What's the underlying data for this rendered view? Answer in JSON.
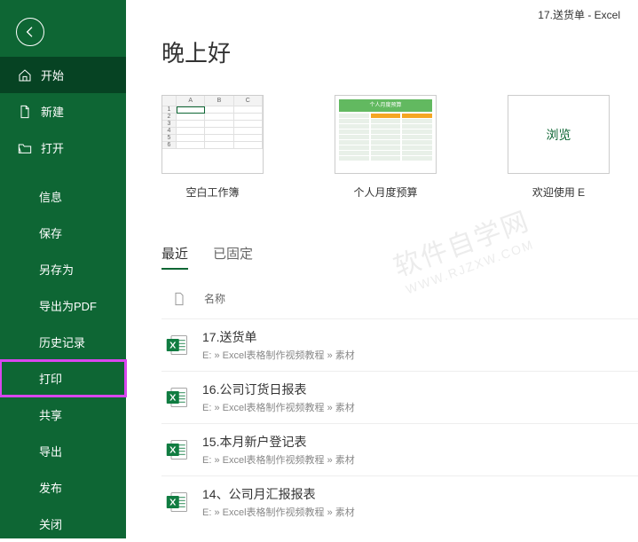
{
  "titlebar": "17.送货单  -  Excel",
  "sidebar": {
    "primary": [
      {
        "label": "开始",
        "icon": "home",
        "active": true
      },
      {
        "label": "新建",
        "icon": "file"
      },
      {
        "label": "打开",
        "icon": "folder-open"
      }
    ],
    "secondary": [
      {
        "label": "信息"
      },
      {
        "label": "保存"
      },
      {
        "label": "另存为"
      },
      {
        "label": "导出为PDF"
      },
      {
        "label": "历史记录"
      },
      {
        "label": "打印",
        "highlighted": true
      },
      {
        "label": "共享"
      },
      {
        "label": "导出"
      },
      {
        "label": "发布"
      },
      {
        "label": "关闭"
      }
    ]
  },
  "page_title": "晚上好",
  "templates": [
    {
      "label": "空白工作簿",
      "type": "blank"
    },
    {
      "label": "个人月度预算",
      "type": "budget",
      "preview_title": "个人月度预算"
    },
    {
      "label": "欢迎使用 E",
      "type": "browse",
      "browse_text": "浏览"
    }
  ],
  "tabs": [
    {
      "label": "最近",
      "active": true
    },
    {
      "label": "已固定"
    }
  ],
  "list_header": {
    "name_col": "名称"
  },
  "recent_files": [
    {
      "name": "17.送货单",
      "path": "E: » Excel表格制作视频教程 » 素材"
    },
    {
      "name": "16.公司订货日报表",
      "path": "E: » Excel表格制作视频教程 » 素材"
    },
    {
      "name": "15.本月新户登记表",
      "path": "E: » Excel表格制作视频教程 » 素材"
    },
    {
      "name": "14、公司月汇报报表",
      "path": "E: » Excel表格制作视频教程 » 素材"
    }
  ],
  "watermark": {
    "main": "软件自学网",
    "sub": "WWW.RJZXW.COM"
  },
  "colors": {
    "accent": "#0e6634",
    "highlight": "#d946ef"
  }
}
